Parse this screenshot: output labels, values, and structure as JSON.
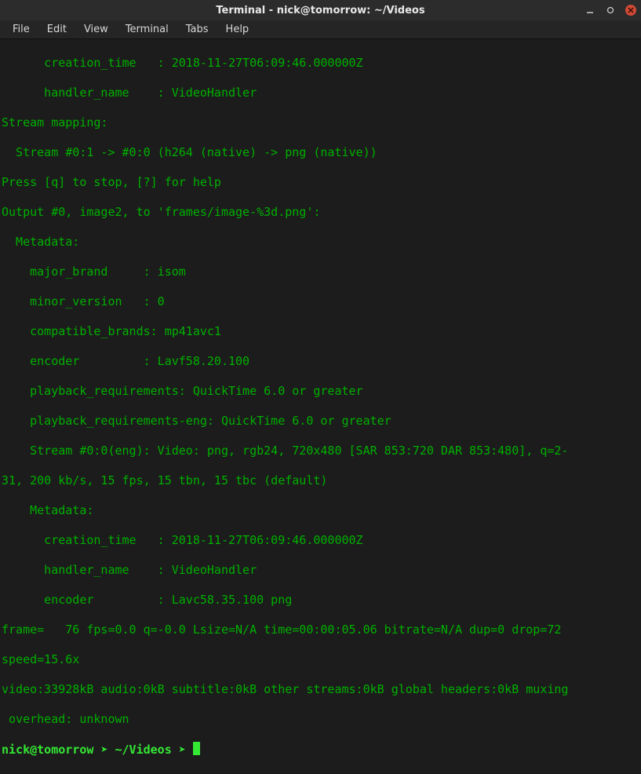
{
  "window": {
    "title": "Terminal - nick@tomorrow: ~/Videos"
  },
  "menu": {
    "file": "File",
    "edit": "Edit",
    "view": "View",
    "terminal": "Terminal",
    "tabs": "Tabs",
    "help": "Help"
  },
  "lines": {
    "l0": "      creation_time   : 2018-11-27T06:09:46.000000Z",
    "l1": "      handler_name    : VideoHandler",
    "l2": "Stream mapping:",
    "l3": "  Stream #0:1 -> #0:0 (h264 (native) -> png (native))",
    "l4": "Press [q] to stop, [?] for help",
    "l5": "Output #0, image2, to 'frames/image-%3d.png':",
    "l6": "  Metadata:",
    "l7": "    major_brand     : isom",
    "l8": "    minor_version   : 0",
    "l9": "    compatible_brands: mp41avc1",
    "l10": "    encoder         : Lavf58.20.100",
    "l11": "    playback_requirements: QuickTime 6.0 or greater",
    "l12": "    playback_requirements-eng: QuickTime 6.0 or greater",
    "l13": "    Stream #0:0(eng): Video: png, rgb24, 720x480 [SAR 853:720 DAR 853:480], q=2-",
    "l14": "31, 200 kb/s, 15 fps, 15 tbn, 15 tbc (default)",
    "l15": "    Metadata:",
    "l16": "      creation_time   : 2018-11-27T06:09:46.000000Z",
    "l17": "      handler_name    : VideoHandler",
    "l18": "      encoder         : Lavc58.35.100 png",
    "l19": "frame=   76 fps=0.0 q=-0.0 Lsize=N/A time=00:00:05.06 bitrate=N/A dup=0 drop=72",
    "l20": "speed=15.6x    ",
    "l21": "video:33928kB audio:0kB subtitle:0kB other streams:0kB global headers:0kB muxing",
    "l22": " overhead: unknown"
  },
  "prompt": {
    "user": "nick@tomorrow",
    "sep1": " ",
    "arrow1": "➤",
    "sep2": " ",
    "path": "~/Videos",
    "sep3": " ",
    "arrow2": "➤",
    "sep4": " "
  }
}
